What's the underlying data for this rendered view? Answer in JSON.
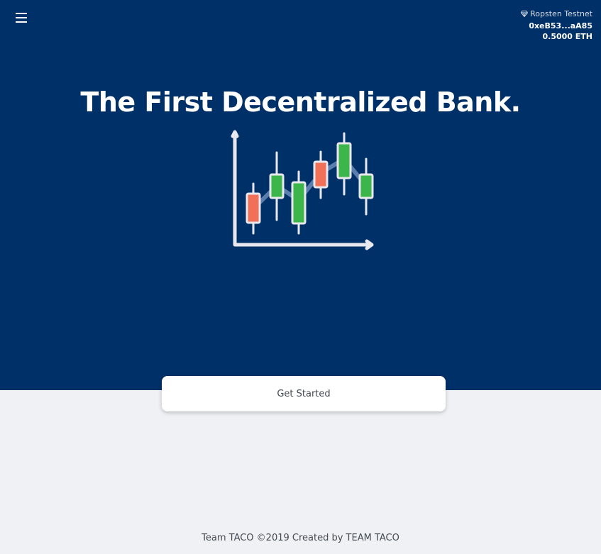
{
  "header": {
    "menu_icon": "hamburger-menu-icon",
    "network_icon": "ethereum-diamond-icon",
    "network": "Ropsten Testnet",
    "address": "0xeB53...aA85",
    "balance": "0.5000 ETH"
  },
  "hero": {
    "title": "The First Decentralized Bank.",
    "illustration_icon": "candlestick-chart-icon",
    "colors": {
      "background": "#003068",
      "bullish": "#3cb54a",
      "bearish": "#f07058",
      "axis": "#e8e8ee",
      "trend": "#5a7fae"
    }
  },
  "cta": {
    "label": "Get Started"
  },
  "footer": {
    "text": "Team TACO ©2019 Created by TEAM TACO"
  }
}
